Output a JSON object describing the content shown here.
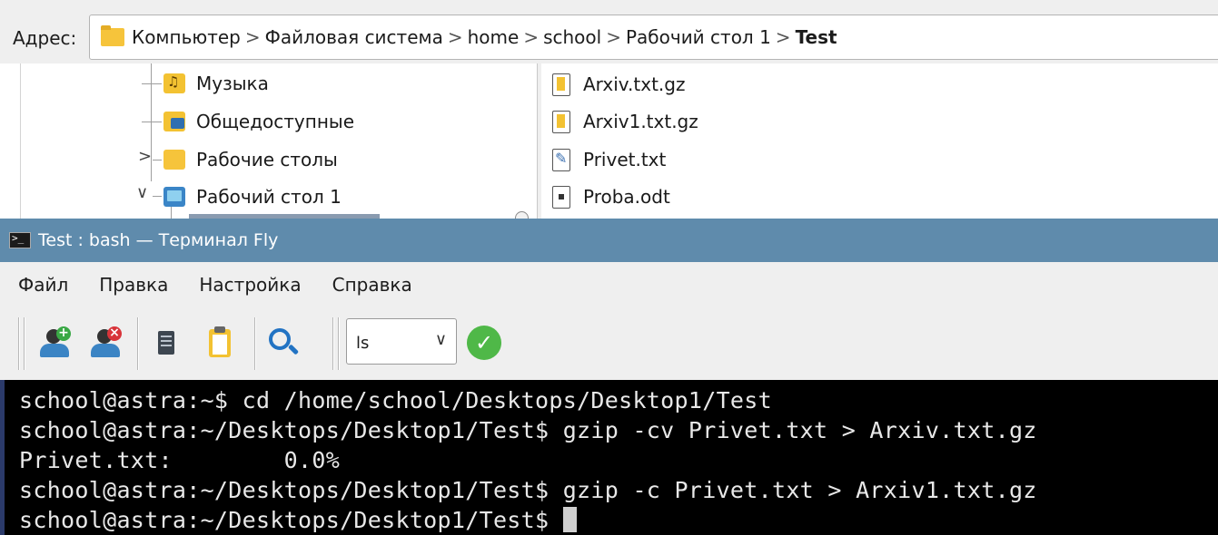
{
  "address": {
    "label": "Адрес:",
    "crumbs": [
      "Компьютер",
      "Файловая система",
      "home",
      "school",
      "Рабочий стол 1",
      "Test"
    ],
    "separator": ">"
  },
  "tree": {
    "items": [
      {
        "label": "Музыка",
        "icon": "music-folder-icon"
      },
      {
        "label": "Общедоступные",
        "icon": "public-folder-icon"
      },
      {
        "label": "Рабочие столы",
        "icon": "folder-icon",
        "arrow": ">"
      },
      {
        "label": "Рабочий стол 1",
        "icon": "desktop-folder-icon",
        "arrow": "∨"
      }
    ]
  },
  "files": [
    {
      "name": "Arxiv.txt.gz",
      "icon": "archive-file-icon"
    },
    {
      "name": "Arxiv1.txt.gz",
      "icon": "archive-file-icon"
    },
    {
      "name": "Privet.txt",
      "icon": "text-file-icon"
    },
    {
      "name": "Proba.odt",
      "icon": "document-file-icon"
    }
  ],
  "terminal_window": {
    "title": "Test : bash — Терминал Fly",
    "menu": [
      "Файл",
      "Правка",
      "Настройка",
      "Справка"
    ],
    "command_combo": {
      "value": "ls",
      "chevron": "∨"
    },
    "ok_glyph": "✓",
    "add_glyph": "+",
    "del_glyph": "×"
  },
  "terminal": {
    "lines": [
      "school@astra:~$ cd /home/school/Desktops/Desktop1/Test",
      "school@astra:~/Desktops/Desktop1/Test$ gzip -cv Privet.txt > Arxiv.txt.gz",
      "Privet.txt:\t   0.0%",
      "school@astra:~/Desktops/Desktop1/Test$ gzip -c Privet.txt > Arxiv1.txt.gz",
      "school@astra:~/Desktops/Desktop1/Test$ "
    ]
  },
  "colors": {
    "title_bar": "#5f8bac",
    "terminal_bg": "#000000",
    "terminal_fg": "#e8e8e8",
    "folder": "#f6c43b"
  }
}
